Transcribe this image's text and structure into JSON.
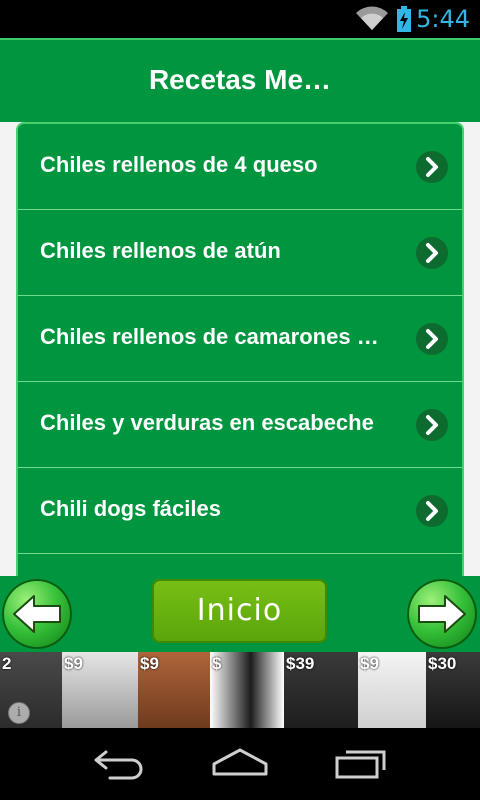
{
  "status_bar": {
    "time": "5:44",
    "icons": [
      "wifi-icon",
      "battery-icon"
    ]
  },
  "header": {
    "title": "Recetas Me…"
  },
  "recipes": [
    {
      "label": "Chiles rellenos de 4 queso"
    },
    {
      "label": "Chiles rellenos de atún"
    },
    {
      "label": "Chiles rellenos de camarones y …"
    },
    {
      "label": "Chiles y verduras en escabeche"
    },
    {
      "label": "Chili dogs fáciles"
    },
    {
      "label": ""
    }
  ],
  "nav": {
    "home_label": "Inicio",
    "back_icon": "arrow-left-icon",
    "forward_icon": "arrow-right-icon"
  },
  "ad": {
    "prices": [
      "2",
      "$9",
      "$9",
      "$",
      "$39",
      "$9",
      "$30"
    ],
    "info_symbol": "i"
  },
  "colors": {
    "primary_green": "#00953f",
    "list_border": "#44d06e",
    "home_button": "#6db210",
    "status_accent": "#33b5e5"
  }
}
